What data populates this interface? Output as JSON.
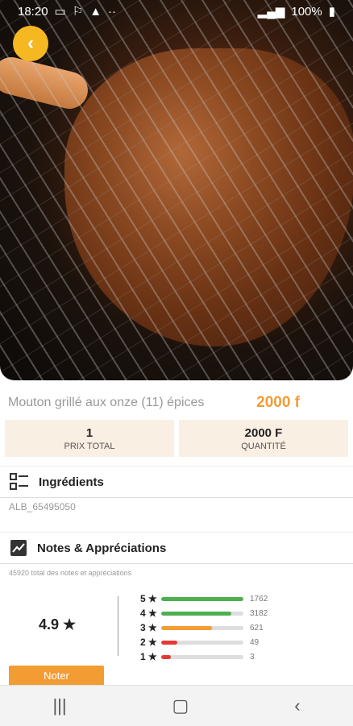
{
  "status": {
    "time": "18:20",
    "battery": "100%",
    "dots": "··"
  },
  "hero": {
    "image_alt": "grilled lamb leg on grill"
  },
  "product": {
    "name": "Mouton grillé aux onze (11) épices",
    "price": "2000 f"
  },
  "info_boxes": [
    {
      "value": "1",
      "label": "PRIX TOTAL"
    },
    {
      "value": "2000 F",
      "label": "QUANTITÉ"
    }
  ],
  "ingredients": {
    "title": "Ingrédients",
    "text": "ALB_65495050"
  },
  "notes": {
    "title": "Notes & Appréciations",
    "summary": "45920 total des notes et appréciations",
    "average": "4.9",
    "bars": [
      {
        "label": "5",
        "count": "1762",
        "fill": 1.0,
        "color": "#4caf50"
      },
      {
        "label": "4",
        "count": "3182",
        "fill": 0.85,
        "color": "#4caf50"
      },
      {
        "label": "3",
        "count": "621",
        "fill": 0.62,
        "color": "#f39c33"
      },
      {
        "label": "2",
        "count": "49",
        "fill": 0.2,
        "color": "#e53935"
      },
      {
        "label": "1",
        "count": "3",
        "fill": 0.12,
        "color": "#e53935"
      }
    ],
    "button_label": "Noter"
  },
  "colors": {
    "accent": "#f39c33",
    "back": "#f5b820",
    "box": "#faefe3"
  },
  "icons": [
    "back-arrow-icon",
    "list-icon",
    "chart-icon",
    "star-icon",
    "recents-icon",
    "home-icon",
    "back-nav-icon"
  ]
}
